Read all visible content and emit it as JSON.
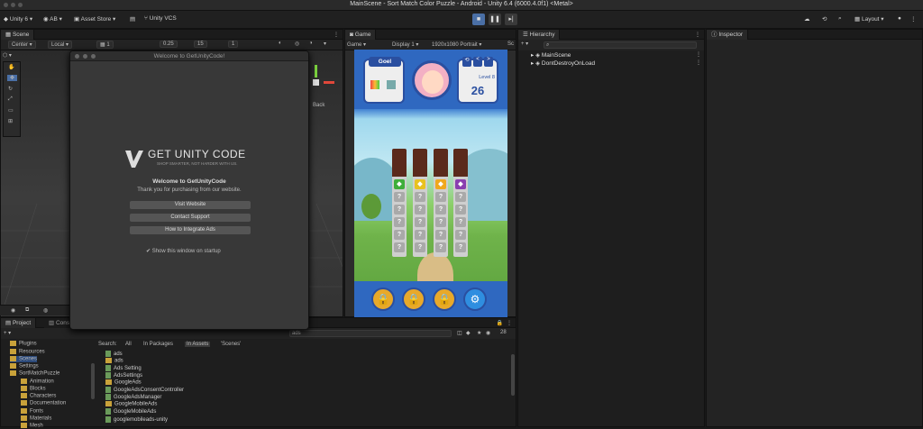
{
  "window": {
    "title": "MainScene - Sort Match Color Puzzle - Android - Unity 6.4 (6000.4.0f1) <Metal>"
  },
  "toolbar": {
    "unity": "Unity 6",
    "account": "AB",
    "asset_store": "Asset Store",
    "vcs": "Unity VCS",
    "layout": "Layout"
  },
  "scene": {
    "tab": "Scene",
    "pivot": "Center",
    "space": "Local",
    "grid": "1",
    "snap": "0.25",
    "angle": "15",
    "scale": "1",
    "back": "Back"
  },
  "game": {
    "tab": "Game",
    "mode": "Game",
    "display": "Display 1",
    "resolution": "1920x1080 Portrait",
    "scale_short": "Sc",
    "player": "Goel",
    "level": "Level 8",
    "moves": "26"
  },
  "hierarchy": {
    "tab": "Hierarchy",
    "search_icon": "search-icon",
    "items": [
      "MainScene",
      "DontDestroyOnLoad"
    ]
  },
  "inspector": {
    "tab": "Inspector"
  },
  "dialog": {
    "title": "Welcome to GetUnityCode!",
    "brand": "GET UNITY CODE",
    "tagline": "SHOP SMARTER, NOT HARDER WITH US.",
    "welcome": "Welcome to GetUnityCode",
    "thanks": "Thank you for purchasing from our website.",
    "buttons": [
      "Visit Website",
      "Contact Support",
      "How to Integrate Ads"
    ],
    "checkbox": "Show this window on startup"
  },
  "project": {
    "tabs": [
      "Project",
      "Conso"
    ],
    "folders": [
      "Plugins",
      "Resources",
      "Scenes",
      "Settings",
      "SortMatchPuzzle",
      "Animation",
      "Blocks",
      "Characters",
      "Documentation",
      "Fonts",
      "Materials",
      "Mesh"
    ],
    "search_value": "ads",
    "search_label": "Search:",
    "filters": [
      "All",
      "In Packages",
      "In Assets",
      "'Scenes'"
    ],
    "files": [
      "ads",
      "ads",
      "Ads Setting",
      "AdsSettings",
      "GoogleAds",
      "GoogleAdsConsentController",
      "GoogleAdsManager",
      "GoogleMobileAds",
      "GoogleMobileAds",
      "googlemobileads-unity"
    ],
    "count": "28"
  },
  "colors": {
    "accent": "#4a6fa5",
    "dialog_bg": "#383838",
    "game_sky": "#8fd0e8",
    "lock": "#e8a92a"
  }
}
